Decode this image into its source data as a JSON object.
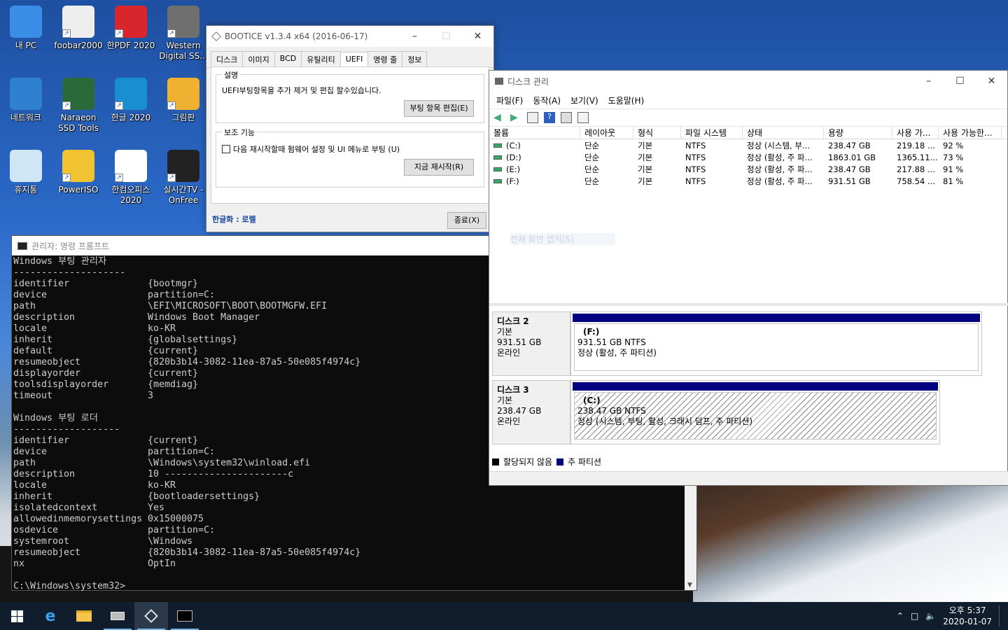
{
  "desktop": {
    "icons": [
      {
        "label": "내 PC",
        "icon": "pc-icon"
      },
      {
        "label": "foobar2000",
        "icon": "foobar-icon"
      },
      {
        "label": "한PDF 2020",
        "icon": "pdf-icon"
      },
      {
        "label": "Western\nDigital SS...",
        "icon": "wd-ssd-icon"
      },
      {
        "label": "네트워크",
        "icon": "network-icon"
      },
      {
        "label": "Naraeon\nSSD Tools",
        "icon": "naraeon-icon"
      },
      {
        "label": "한글 2020",
        "icon": "hangul-icon"
      },
      {
        "label": "그림판",
        "icon": "paint-icon"
      },
      {
        "label": "휴지통",
        "icon": "recycle-bin-icon"
      },
      {
        "label": "PowerISO",
        "icon": "poweriso-icon"
      },
      {
        "label": "한컴오피스\n2020",
        "icon": "hancom-office-icon"
      },
      {
        "label": "실시간TV -\nOnFree",
        "icon": "tv-icon"
      }
    ]
  },
  "bootice": {
    "title": "BOOTICE v1.3.4 x64 (2016-06-17)",
    "tabs": [
      "디스크",
      "이미지",
      "BCD",
      "유틸리티",
      "UEFI",
      "명령 줄",
      "정보"
    ],
    "active_tab": "UEFI",
    "group1_label": "설명",
    "description": "UEFI부팅항목을 추가 제거 및 편집 할수있습니다.",
    "edit_button": "부팅 항목 편집(E)",
    "group2_label": "보조 기능",
    "checkbox_label": "다음 재시작할때 펌웨어 설정 및 UI 메뉴로 부팅 (U)",
    "restart_button": "지금 재시작(R)",
    "footer_link": "한글화 : 로렐",
    "close_button": "종료(X)"
  },
  "cmd": {
    "title": "관리자: 명령 프롬프트",
    "section1_title": "Windows 부팅 관리자",
    "section1_rule": "--------------------",
    "section1": [
      {
        "k": "identifier",
        "v": "{bootmgr}"
      },
      {
        "k": "device",
        "v": "partition=C:"
      },
      {
        "k": "path",
        "v": "\\EFI\\MICROSOFT\\BOOT\\BOOTMGFW.EFI"
      },
      {
        "k": "description",
        "v": "Windows Boot Manager"
      },
      {
        "k": "locale",
        "v": "ko-KR"
      },
      {
        "k": "inherit",
        "v": "{globalsettings}"
      },
      {
        "k": "default",
        "v": "{current}"
      },
      {
        "k": "resumeobject",
        "v": "{820b3b14-3082-11ea-87a5-50e085f4974c}"
      },
      {
        "k": "displayorder",
        "v": "{current}"
      },
      {
        "k": "toolsdisplayorder",
        "v": "{memdiag}"
      },
      {
        "k": "timeout",
        "v": "3"
      }
    ],
    "section2_title": "Windows 부팅 로더",
    "section2_rule": "-------------------",
    "section2": [
      {
        "k": "identifier",
        "v": "{current}"
      },
      {
        "k": "device",
        "v": "partition=C:"
      },
      {
        "k": "path",
        "v": "\\Windows\\system32\\winload.efi"
      },
      {
        "k": "description",
        "v": "10 ----------------------c"
      },
      {
        "k": "locale",
        "v": "ko-KR"
      },
      {
        "k": "inherit",
        "v": "{bootloadersettings}"
      },
      {
        "k": "isolatedcontext",
        "v": "Yes"
      },
      {
        "k": "allowedinmemorysettings",
        "v": "0x15000075"
      },
      {
        "k": "osdevice",
        "v": "partition=C:"
      },
      {
        "k": "systemroot",
        "v": "\\Windows"
      },
      {
        "k": "resumeobject",
        "v": "{820b3b14-3082-11ea-87a5-50e085f4974c}"
      },
      {
        "k": "nx",
        "v": "OptIn"
      }
    ],
    "prompt": "C:\\Windows\\system32>"
  },
  "diskmgmt": {
    "title": "디스크 관리",
    "menu": [
      "파일(F)",
      "동작(A)",
      "보기(V)",
      "도움말(H)"
    ],
    "columns": [
      "볼륨",
      "레이아웃",
      "형식",
      "파일 시스템",
      "상태",
      "용량",
      "사용 가...",
      "사용 가능한..."
    ],
    "volumes": [
      [
        "(C:)",
        "단순",
        "기본",
        "NTFS",
        "정상 (시스템, 부...",
        "238.47 GB",
        "219.18 ...",
        "92 %"
      ],
      [
        "(D:)",
        "단순",
        "기본",
        "NTFS",
        "정상 (활성, 주 파...",
        "1863.01 GB",
        "1365.11...",
        "73 %"
      ],
      [
        "(E:)",
        "단순",
        "기본",
        "NTFS",
        "정상 (활성, 주 파...",
        "238.47 GB",
        "217.88 ...",
        "91 %"
      ],
      [
        "(F:)",
        "단순",
        "기본",
        "NTFS",
        "정상 (활성, 주 파...",
        "931.51 GB",
        "758.54 ...",
        "81 %"
      ]
    ],
    "ghost_text": "전체 화면 캡처(S)",
    "disks": [
      {
        "name": "디스크 2",
        "type": "기본",
        "size": "931.51 GB",
        "status": "온라인",
        "part_letter": "(F:)",
        "part_size": "931.51 GB NTFS",
        "part_status": "정상 (활성, 주 파티션)"
      },
      {
        "name": "디스크 3",
        "type": "기본",
        "size": "238.47 GB",
        "status": "온라인",
        "part_letter": "(C:)",
        "part_size": "238.47 GB NTFS",
        "part_status": "정상 (시스템, 부팅, 활성, 크래시 덤프, 주 파티션)"
      }
    ],
    "legend_unallocated": "할당되지 않음",
    "legend_primary": "주 파티션"
  },
  "taskbar": {
    "time": "오후 5:37",
    "date": "2020-01-07"
  },
  "colors": {
    "primary_partition": "#000080",
    "taskbar": "#101d2c",
    "cmd_bg": "#0c0c0c"
  }
}
